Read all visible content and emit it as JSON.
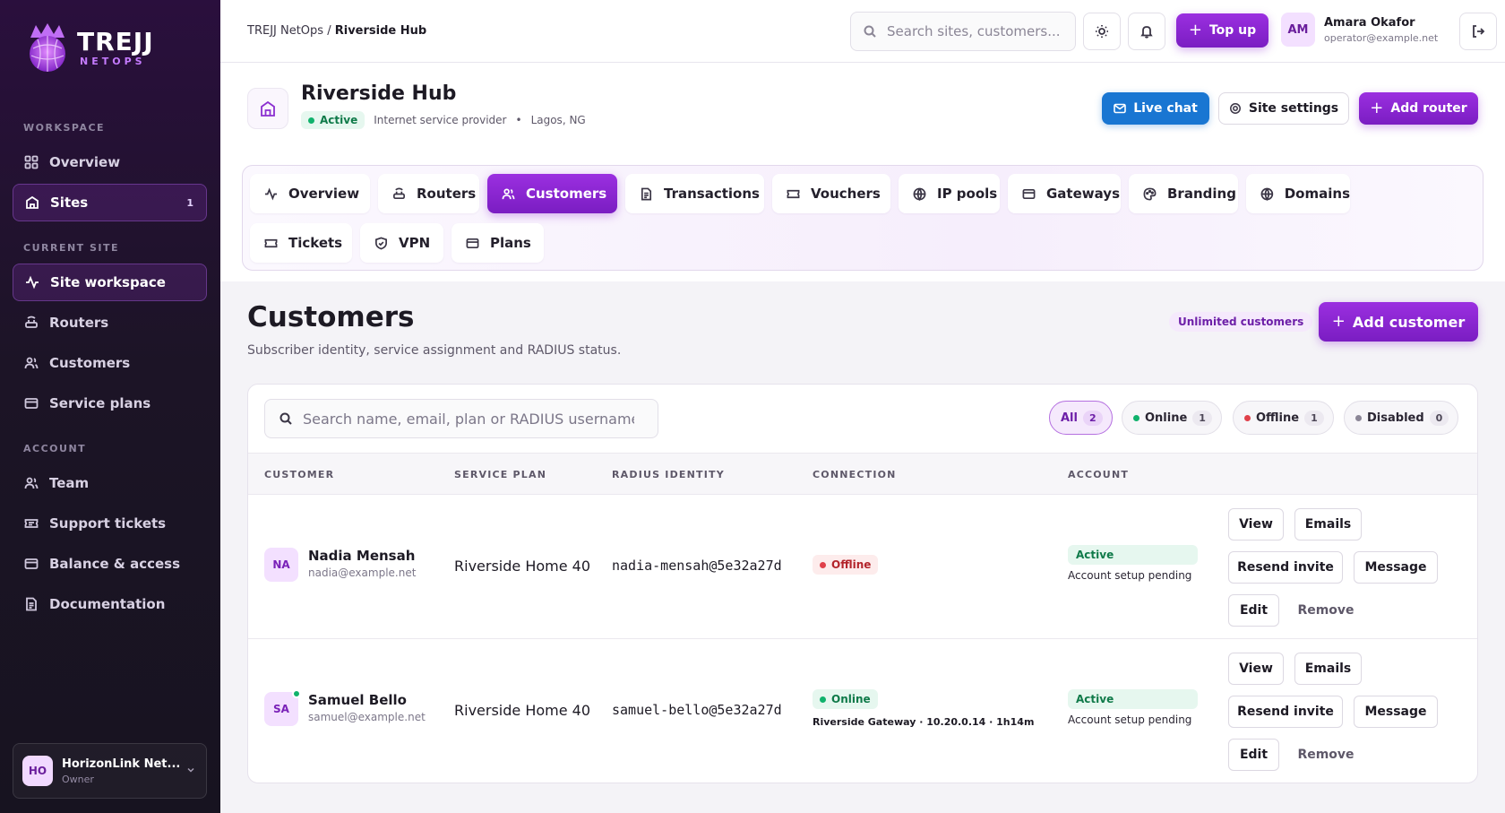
{
  "brand": {
    "name": "TREJJ",
    "sub": "NETOPS"
  },
  "sidebar": {
    "workspace_title": "WORKSPACE",
    "workspace_items": [
      {
        "label": "Overview",
        "icon": "grid-icon"
      },
      {
        "label": "Sites",
        "icon": "building-icon",
        "badge": "1",
        "active": true
      }
    ],
    "current_site_title": "CURRENT SITE",
    "site_items": [
      {
        "label": "Site workspace",
        "icon": "activity-icon",
        "active": true
      },
      {
        "label": "Routers",
        "icon": "router-icon"
      },
      {
        "label": "Customers",
        "icon": "users-icon"
      },
      {
        "label": "Service plans",
        "icon": "card-icon"
      }
    ],
    "account_title": "ACCOUNT",
    "account_items": [
      {
        "label": "Team",
        "icon": "users-icon"
      },
      {
        "label": "Support tickets",
        "icon": "ticket-icon"
      },
      {
        "label": "Balance & access",
        "icon": "card-icon"
      },
      {
        "label": "Documentation",
        "icon": "doc-icon"
      }
    ],
    "org": {
      "initials": "HO",
      "name": "HorizonLink Net...",
      "role": "Owner"
    }
  },
  "topbar": {
    "breadcrumb_root": "TREJJ NetOps",
    "breadcrumb_sep": " / ",
    "breadcrumb_current": "Riverside Hub",
    "search_placeholder": "Search sites, customers...",
    "topup_label": "Top up",
    "user": {
      "initials": "AM",
      "name": "Amara Okafor",
      "email": "operator@example.net"
    }
  },
  "site": {
    "title": "Riverside Hub",
    "status": "Active",
    "type": "Internet service provider",
    "location": "Lagos, NG",
    "live_chat_label": "Live chat",
    "settings_label": "Site settings",
    "add_router_label": "Add router"
  },
  "tabs": [
    {
      "label": "Overview",
      "icon": "activity-icon"
    },
    {
      "label": "Routers",
      "icon": "router-icon"
    },
    {
      "label": "Customers",
      "icon": "users-icon",
      "active": true
    },
    {
      "label": "Transactions",
      "icon": "doc-icon"
    },
    {
      "label": "Vouchers",
      "icon": "ticket-icon"
    },
    {
      "label": "IP pools",
      "icon": "globe-icon"
    },
    {
      "label": "Gateways",
      "icon": "card-icon"
    },
    {
      "label": "Branding",
      "icon": "palette-icon"
    },
    {
      "label": "Domains",
      "icon": "globe-icon"
    },
    {
      "label": "Tickets",
      "icon": "ticket-icon"
    },
    {
      "label": "VPN",
      "icon": "shield-icon"
    },
    {
      "label": "Plans",
      "icon": "card-icon"
    }
  ],
  "customers": {
    "title": "Customers",
    "subtitle": "Subscriber identity, service assignment and RADIUS status.",
    "limit_badge": "Unlimited customers",
    "add_label": "Add customer",
    "search_placeholder": "Search name, email, plan or RADIUS username",
    "filters": [
      {
        "label": "All",
        "count": "2",
        "active": true,
        "color": ""
      },
      {
        "label": "Online",
        "count": "1",
        "color": "#10b26c"
      },
      {
        "label": "Offline",
        "count": "1",
        "color": "#e0404a"
      },
      {
        "label": "Disabled",
        "count": "0",
        "color": "#8b8696"
      }
    ],
    "columns": [
      "CUSTOMER",
      "SERVICE PLAN",
      "RADIUS IDENTITY",
      "CONNECTION",
      "ACCOUNT"
    ],
    "rows": [
      {
        "initials": "NA",
        "name": "Nadia Mensah",
        "email": "nadia@example.net",
        "plan": "Riverside Home 40",
        "radius": "nadia-mensah@5e32a27d",
        "connection": "Offline",
        "connection_detail": "",
        "account": "Active",
        "account_note": "Account setup pending"
      },
      {
        "initials": "SA",
        "name": "Samuel Bello",
        "email": "samuel@example.net",
        "plan": "Riverside Home 40",
        "radius": "samuel-bello@5e32a27d",
        "connection": "Online",
        "connection_detail": "Riverside Gateway · 10.20.0.14 · 1h14m",
        "account": "Active",
        "account_note": "Account setup pending"
      }
    ],
    "actions": {
      "view": "View",
      "emails": "Emails",
      "resend": "Resend invite",
      "message": "Message",
      "edit": "Edit",
      "remove": "Remove"
    }
  },
  "colors": {
    "accent": "#8b2fd0",
    "sidebar_bg": "#1c1426",
    "online": "#10b26c",
    "offline": "#e0404a",
    "live_chat": "#1976d2"
  }
}
